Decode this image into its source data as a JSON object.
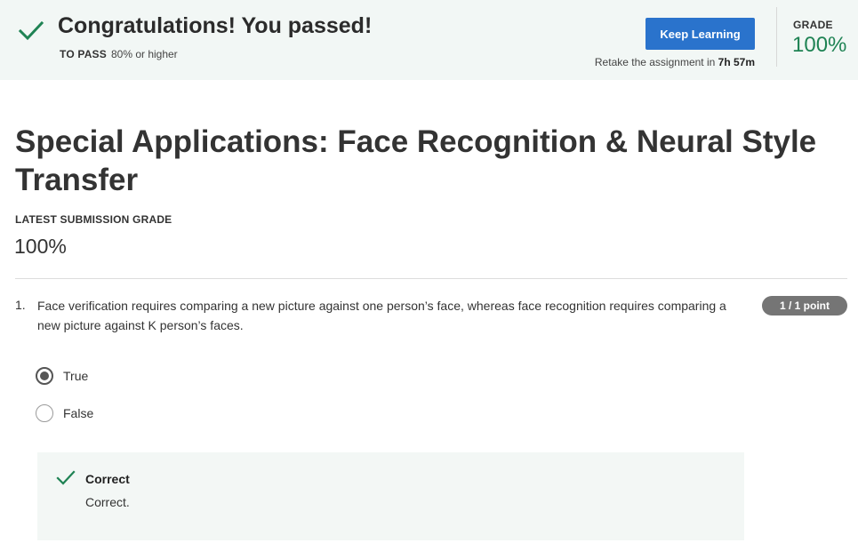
{
  "banner": {
    "title": "Congratulations! You passed!",
    "to_pass_label": "TO PASS",
    "to_pass_value": "80% or higher",
    "keep_learning_label": "Keep Learning",
    "retake_prefix": "Retake the assignment in ",
    "retake_time": "7h 57m",
    "grade_label": "GRADE",
    "grade_value": "100%",
    "check_icon": "check-icon",
    "accent_color": "#1f8354",
    "button_color": "#2a73cc"
  },
  "main": {
    "title": "Special Applications: Face Recognition & Neural Style Transfer",
    "latest_label": "LATEST SUBMISSION GRADE",
    "latest_value": "100%"
  },
  "questions": [
    {
      "number": "1.",
      "text": "Face verification requires comparing a new picture against one person’s face, whereas face recognition requires comparing a new picture against K person’s faces.",
      "points": "1 / 1 point",
      "options": [
        {
          "label": "True",
          "selected": true
        },
        {
          "label": "False",
          "selected": false
        }
      ],
      "feedback": {
        "title": "Correct",
        "text": "Correct.",
        "icon": "check-icon"
      }
    }
  ]
}
